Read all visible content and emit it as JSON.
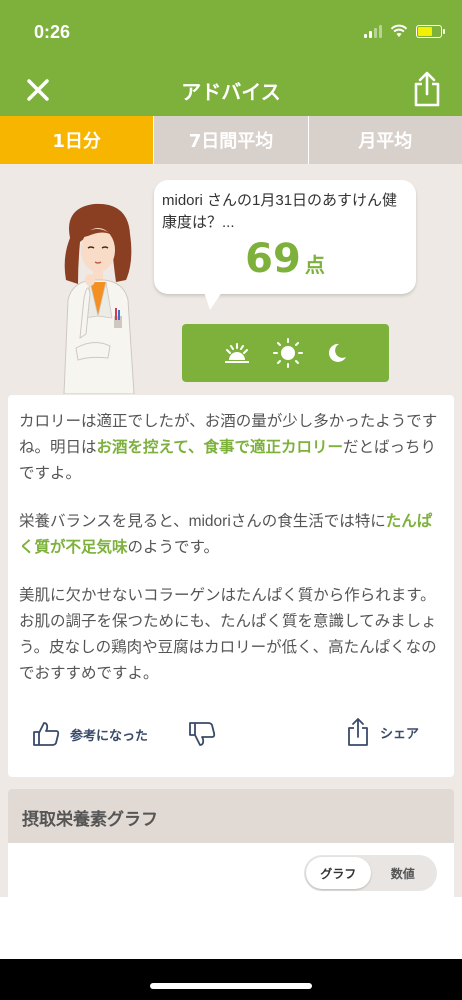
{
  "status": {
    "time": "0:26"
  },
  "nav": {
    "title": "アドバイス"
  },
  "tabs": [
    {
      "label": "1日分",
      "active": true
    },
    {
      "label": "7日間平均",
      "active": false
    },
    {
      "label": "月平均",
      "active": false
    }
  ],
  "bubble": {
    "text": "midori さんの1月31日のあすけん健康度は？...",
    "score": "69",
    "unit": "点"
  },
  "time_of_day": [
    "sunrise-icon",
    "sun-icon",
    "moon-icon"
  ],
  "advice": {
    "p1": [
      "カロリーは適正でしたが、お酒の量が少し多かったようですね。明日は",
      "お酒を控えて、食事で適正カロリー",
      "だとばっちりですよ。"
    ],
    "p2": [
      "栄養バランスを見ると、midoriさんの食生活では特に",
      "たんぱく質が不足気味",
      "のようです。"
    ],
    "p3": "美肌に欠かせないコラーゲンはたんぱく質から作られます。お肌の調子を保つためにも、たんぱく質を意識してみましょう。皮なしの鶏肉や豆腐はカロリーが低く、高たんぱくなのでおすすめですよ。"
  },
  "actions": {
    "helpful": "参考になった",
    "share": "シェア"
  },
  "graph": {
    "title": "摂取栄養素グラフ",
    "segments": [
      {
        "label": "グラフ",
        "active": true
      },
      {
        "label": "数値",
        "active": false
      }
    ]
  },
  "colors": {
    "primary": "#7db13c",
    "tab_active": "#f7b500",
    "tab_inactive": "#d7d0cb",
    "background": "#eee9e4"
  }
}
